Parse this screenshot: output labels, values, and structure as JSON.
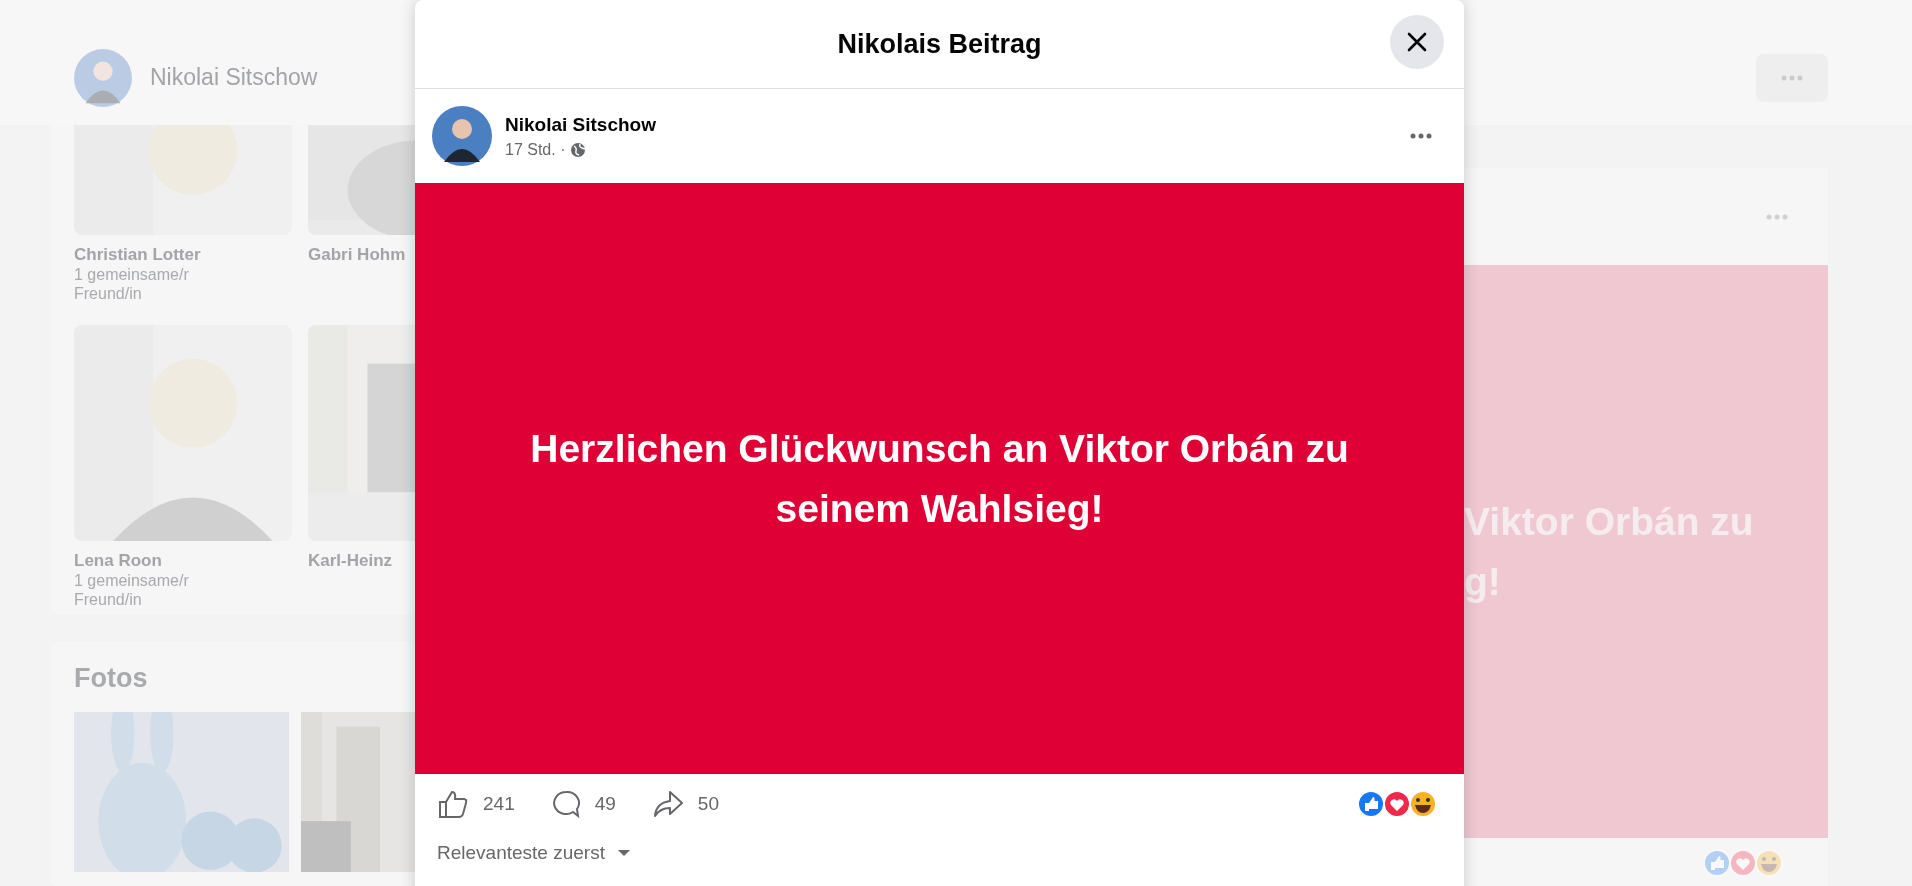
{
  "background": {
    "profile_name": "Nikolai Sitschow",
    "friends": [
      {
        "name": "Christian Lotter",
        "mutual": "1 gemeinsame/r Freund/in"
      },
      {
        "name": "Gabri Hohm"
      },
      {
        "name": "Lena Roon",
        "mutual": "1 gemeinsame/r Freund/in"
      },
      {
        "name": "Karl-Heinz"
      }
    ],
    "photos_title": "Fotos",
    "post_text_lines": [
      "Viktor Orbán zu",
      "g!"
    ]
  },
  "modal": {
    "title": "Nikolais Beitrag",
    "post": {
      "author": "Nikolai Sitschow",
      "time": "17 Std. ·",
      "text": "Herzlichen Glückwunsch an Viktor Orbán zu seinem Wahlsieg!",
      "likes": "241",
      "comments": "49",
      "shares": "50",
      "sort": "Relevanteste zuerst"
    }
  }
}
